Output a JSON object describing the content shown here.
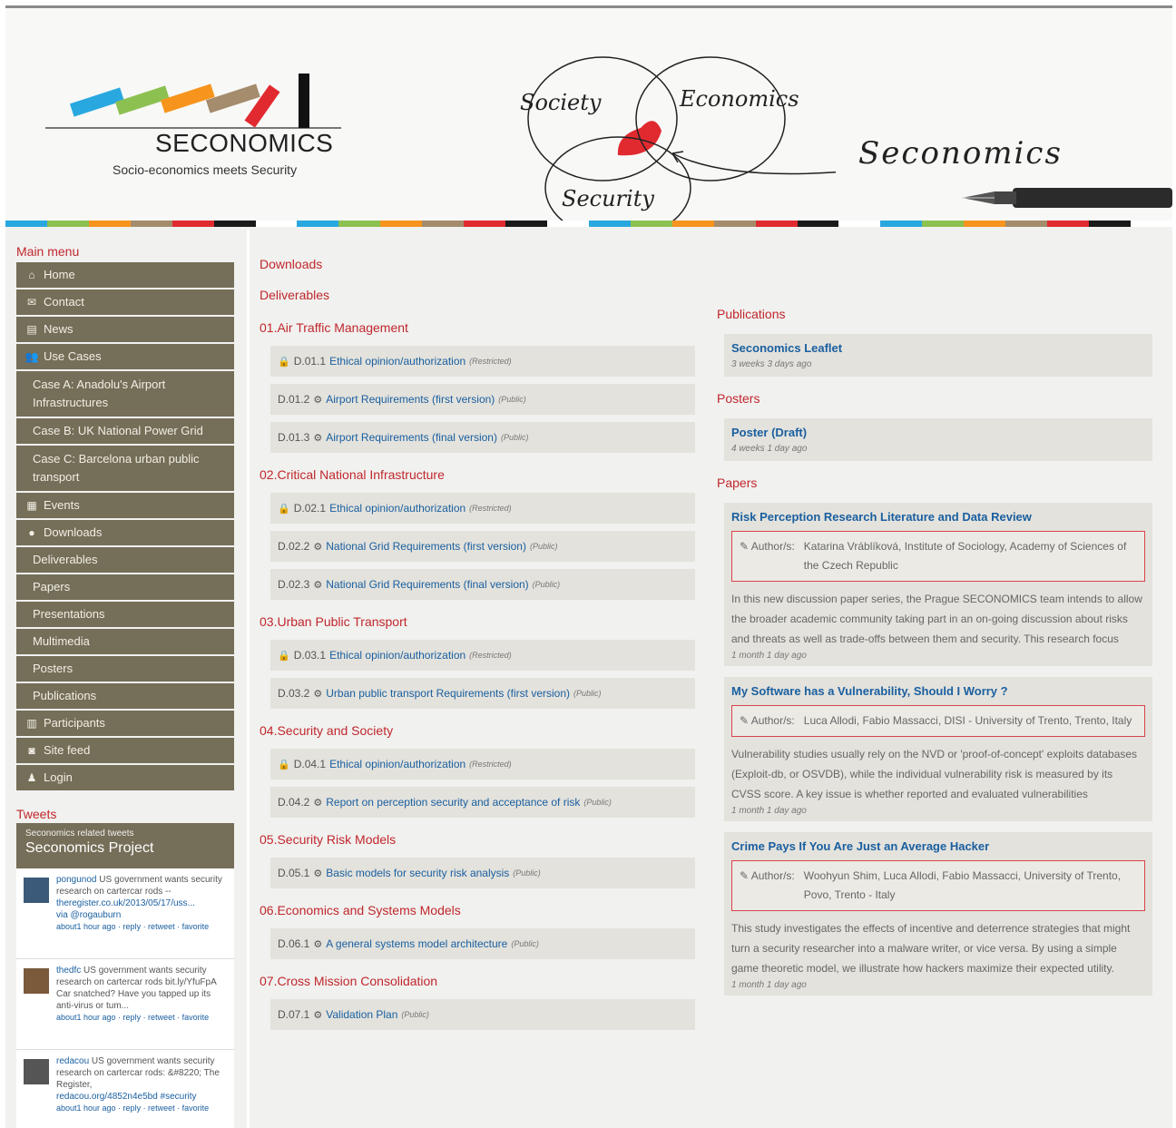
{
  "header": {
    "logo_title": "SECONOMICS",
    "logo_subtitle": "Socio-economics meets Security",
    "venn_society": "Society",
    "venn_economics": "Economics",
    "venn_security": "Security",
    "brand_script": "Seconomics"
  },
  "colors": {
    "accent_red": "#c0272d",
    "menu_bg": "#756e58",
    "link_blue": "#1a5fa0",
    "colorbar": [
      "#29a8e0",
      "#8cc152",
      "#f7941d",
      "#a48c6c",
      "#e02a2f",
      "#1a1a1a",
      "#ffffff"
    ]
  },
  "sidebar": {
    "heading": "Main menu",
    "items": [
      {
        "label": "Home",
        "icon": "home-icon",
        "sub": false
      },
      {
        "label": "Contact",
        "icon": "envelope-icon",
        "sub": false
      },
      {
        "label": "News",
        "icon": "newspaper-icon",
        "sub": false
      },
      {
        "label": "Use Cases",
        "icon": "users-icon",
        "sub": false
      },
      {
        "label": "Case A: Anadolu's Airport Infrastructures",
        "icon": "",
        "sub": true
      },
      {
        "label": "Case B: UK National Power Grid",
        "icon": "",
        "sub": true
      },
      {
        "label": "Case C: Barcelona urban public transport",
        "icon": "",
        "sub": true
      },
      {
        "label": "Events",
        "icon": "calendar-icon",
        "sub": false
      },
      {
        "label": "Downloads",
        "icon": "download-icon",
        "sub": false
      },
      {
        "label": "Deliverables",
        "icon": "",
        "sub": true
      },
      {
        "label": "Papers",
        "icon": "",
        "sub": true
      },
      {
        "label": "Presentations",
        "icon": "",
        "sub": true
      },
      {
        "label": "Multimedia",
        "icon": "",
        "sub": true
      },
      {
        "label": "Posters",
        "icon": "",
        "sub": true
      },
      {
        "label": "Publications",
        "icon": "",
        "sub": true
      },
      {
        "label": "Participants",
        "icon": "building-icon",
        "sub": false
      },
      {
        "label": "Site feed",
        "icon": "rss-icon",
        "sub": false
      },
      {
        "label": "Login",
        "icon": "user-icon",
        "sub": false
      }
    ]
  },
  "tweets": {
    "heading": "Tweets",
    "box_small": "Seconomics related tweets",
    "box_title": "Seconomics Project",
    "items": [
      {
        "user": "pongunod",
        "text": "US government wants security research on cartercar rods --",
        "link": "theregister.co.uk/2013/05/17/uss...",
        "via": "via @rogauburn",
        "actions": "about1 hour ago · reply · retweet · favorite"
      },
      {
        "user": "thedfc",
        "text": "US government wants security research on cartercar rods bit.ly/YfuFpA Car snatched? Have you tapped up its anti-virus or tum...",
        "link": "",
        "via": "",
        "actions": "about1 hour ago · reply · retweet · favorite"
      },
      {
        "user": "redacou",
        "text": "US government wants security research on cartercar rods: &#8220; The Register,",
        "link": "redacou.org/4852n4e5bd #security",
        "via": "",
        "actions": "about1 hour ago · reply · retweet · favorite"
      }
    ]
  },
  "middle": {
    "downloads_label": "Downloads",
    "deliverables_label": "Deliverables",
    "sections": [
      {
        "title": "01.Air Traffic Management",
        "rows": [
          {
            "lock": true,
            "id": "D.01.1",
            "title": "Ethical opinion/authorization",
            "access": "(Restricted)"
          },
          {
            "lock": false,
            "id": "D.01.2",
            "title": "Airport Requirements (first version)",
            "access": "(Public)"
          },
          {
            "lock": false,
            "id": "D.01.3",
            "title": "Airport Requirements (final version)",
            "access": "(Public)"
          }
        ]
      },
      {
        "title": "02.Critical National Infrastructure",
        "rows": [
          {
            "lock": true,
            "id": "D.02.1",
            "title": "Ethical opinion/authorization",
            "access": "(Restricted)"
          },
          {
            "lock": false,
            "id": "D.02.2",
            "title": "National Grid Requirements (first version)",
            "access": "(Public)"
          },
          {
            "lock": false,
            "id": "D.02.3",
            "title": "National Grid Requirements (final version)",
            "access": "(Public)"
          }
        ]
      },
      {
        "title": "03.Urban Public Transport",
        "rows": [
          {
            "lock": true,
            "id": "D.03.1",
            "title": "Ethical opinion/authorization",
            "access": "(Restricted)"
          },
          {
            "lock": false,
            "id": "D.03.2",
            "title": "Urban public transport Requirements (first version)",
            "access": "(Public)"
          }
        ]
      },
      {
        "title": "04.Security and Society",
        "rows": [
          {
            "lock": true,
            "id": "D.04.1",
            "title": "Ethical opinion/authorization",
            "access": "(Restricted)"
          },
          {
            "lock": false,
            "id": "D.04.2",
            "title": "Report on perception security and acceptance of risk",
            "access": "(Public)"
          }
        ]
      },
      {
        "title": "05.Security Risk Models",
        "rows": [
          {
            "lock": false,
            "id": "D.05.1",
            "title": "Basic models for security risk analysis",
            "access": "(Public)"
          }
        ]
      },
      {
        "title": "06.Economics and Systems Models",
        "rows": [
          {
            "lock": false,
            "id": "D.06.1",
            "title": "A general systems model architecture",
            "access": "(Public)"
          }
        ]
      },
      {
        "title": "07.Cross Mission Consolidation",
        "rows": [
          {
            "lock": false,
            "id": "D.07.1",
            "title": "Validation Plan",
            "access": "(Public)"
          }
        ]
      }
    ]
  },
  "right": {
    "publications_label": "Publications",
    "publication": {
      "title": "Seconomics Leaflet",
      "date": "3 weeks 3 days ago"
    },
    "posters_label": "Posters",
    "poster": {
      "title": "Poster (Draft)",
      "date": "4 weeks 1 day ago"
    },
    "papers_label": "Papers",
    "author_label": "Author/s:",
    "papers": [
      {
        "title": "Risk Perception Research Literature and Data Review",
        "authors": "Katarina Vráblíková, Institute of Sociology, Academy of Sciences of the Czech Republic",
        "body": "In this new discussion paper series, the Prague SECONOMICS team intends to allow the broader academic community taking part in an on-going discussion about risks and threats as well as trade-offs between them and security. This research focus",
        "date": "1 month 1 day ago"
      },
      {
        "title": "My Software has a Vulnerability, Should I Worry ?",
        "authors": "Luca Allodi, Fabio Massacci, DISI - University of Trento, Trento, Italy",
        "body": "Vulnerability studies usually rely on the NVD or 'proof-of-concept' exploits databases (Exploit-db, or OSVDB), while the individual vulnerability risk is measured by its CVSS score. A key issue is whether reported and evaluated vulnerabilities",
        "date": "1 month 1 day ago"
      },
      {
        "title": "Crime Pays If You Are Just an Average Hacker",
        "authors": "Woohyun Shim, Luca Allodi, Fabio Massacci, University of Trento, Povo, Trento - Italy",
        "body": "This study investigates the effects of incentive and deterrence strategies that might turn a security researcher into a malware writer, or vice versa. By using a simple game theoretic model, we illustrate how hackers maximize their expected utility.",
        "date": "1 month 1 day ago"
      }
    ]
  }
}
